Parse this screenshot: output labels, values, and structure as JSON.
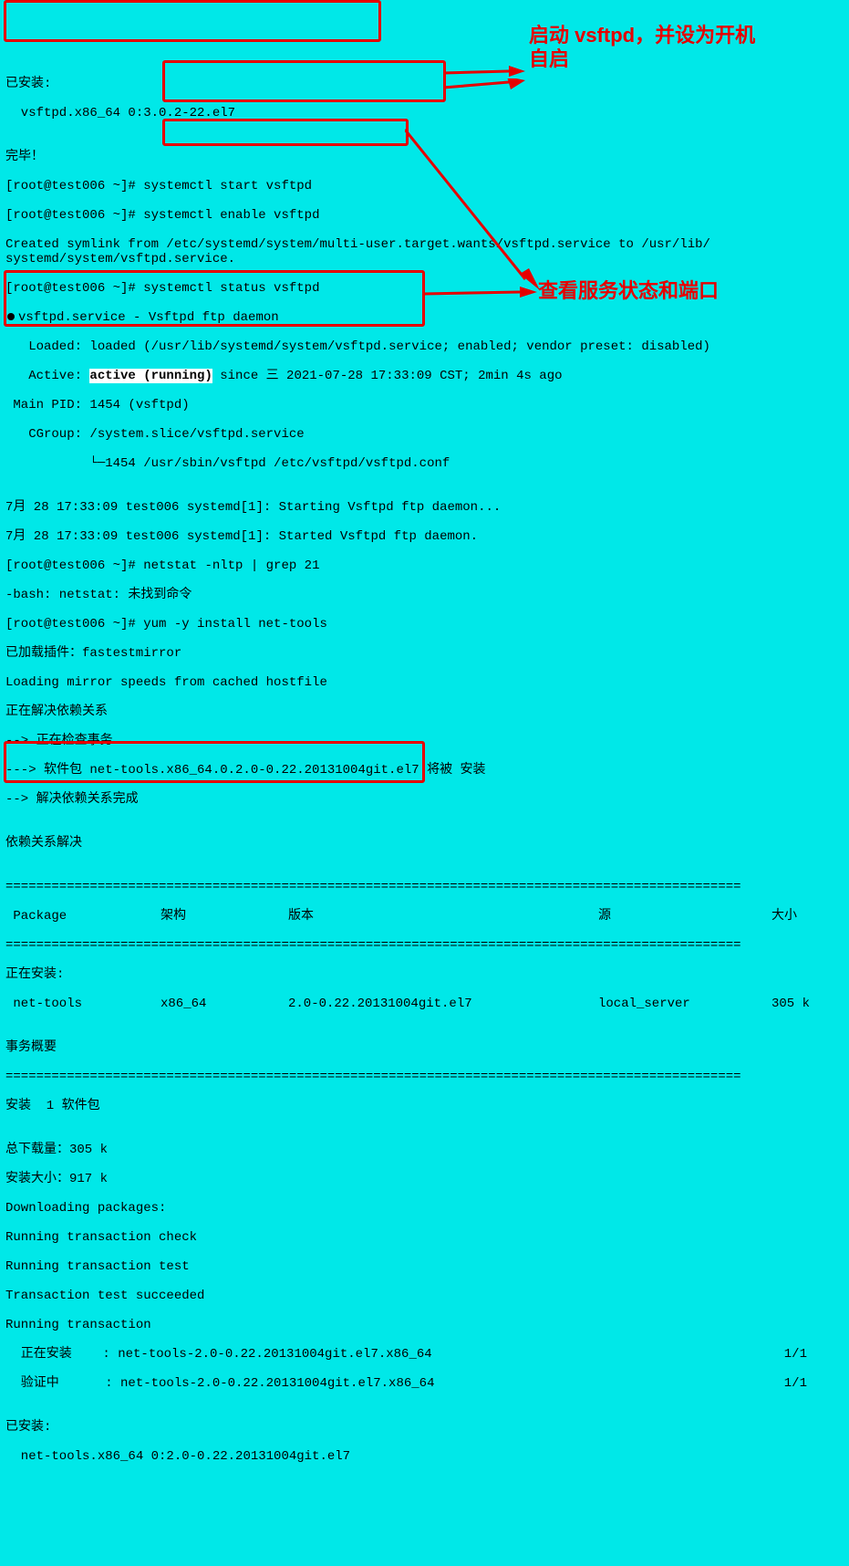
{
  "installed_header": "已安装:",
  "installed_pkg_vsftpd": "  vsftpd.x86_64 0:3.0.2-22.el7",
  "blank": "",
  "done": "完毕！",
  "prompt": "[root@test006 ~]# ",
  "cmd_start": "systemctl start vsftpd",
  "cmd_enable": "systemctl enable vsftpd",
  "symlink_line": "Created symlink from /etc/systemd/system/multi-user.target.wants/vsftpd.service to /usr/lib/\nsystemd/system/vsftpd.service.",
  "cmd_status": "systemctl status vsftpd",
  "status_unit": "vsftpd.service - Vsftpd ftp daemon",
  "status_loaded": "   Loaded: loaded (/usr/lib/systemd/system/vsftpd.service; enabled; vendor preset: disabled)",
  "status_active_pre": "   Active: ",
  "status_active_val": "active (running)",
  "status_active_post": " since 三 2021-07-28 17:33:09 CST; 2min 4s ago",
  "status_mainpid": " Main PID: 1454 (vsftpd)",
  "status_cgroup": "   CGroup: /system.slice/vsftpd.service",
  "status_cgroup2": "           └─1454 /usr/sbin/vsftpd /etc/vsftpd/vsftpd.conf",
  "log1": "7月 28 17:33:09 test006 systemd[1]: Starting Vsftpd ftp daemon...",
  "log2": "7月 28 17:33:09 test006 systemd[1]: Started Vsftpd ftp daemon.",
  "cmd_netstat": "netstat -nltp | grep 21",
  "netstat_err": "-bash: netstat: 未找到命令",
  "cmd_yum": "yum -y install net-tools",
  "yum_plugin": "已加载插件：fastestmirror",
  "yum_mirror": "Loading mirror speeds from cached hostfile",
  "yum_dep1": "正在解决依赖关系",
  "yum_dep2": "--> 正在检查事务",
  "yum_dep3": "---> 软件包 net-tools.x86_64.0.2.0-0.22.20131004git.el7 将被 安装",
  "yum_dep4": "--> 解决依赖关系完成",
  "yum_dep_resolved": "依赖关系解决",
  "tbl_sep": "================================================================================================",
  "tbl_hdr_pkg": " Package",
  "tbl_hdr_arch": "架构",
  "tbl_hdr_ver": "版本",
  "tbl_hdr_src": "源",
  "tbl_hdr_size": "大小",
  "tbl_installing": "正在安装:",
  "tbl_pkg": " net-tools",
  "tbl_arch": "x86_64",
  "tbl_ver": "2.0-0.22.20131004git.el7",
  "tbl_src": "local_server",
  "tbl_size": "305 k",
  "trans_summary": "事务概要",
  "install_count": "安装  1 软件包",
  "total_dl": "总下载量：305 k",
  "install_size": "安装大小：917 k",
  "dl_pkgs": "Downloading packages:",
  "run_check": "Running transaction check",
  "run_test": "Running transaction test",
  "test_ok": "Transaction test succeeded",
  "run_trans": "Running transaction",
  "installing_line": "  正在安装    : net-tools-2.0-0.22.20131004git.el7.x86_64",
  "verifying_line": "  验证中      : net-tools-2.0-0.22.20131004git.el7.x86_64",
  "frac": "1/1",
  "installed_header2": "已安装:",
  "installed_pkg_nettools": "  net-tools.x86_64 0:2.0-0.22.20131004git.el7",
  "annot1": "启动 vsftpd，并设为开机自启",
  "annot2": "查看服务状态和端口"
}
